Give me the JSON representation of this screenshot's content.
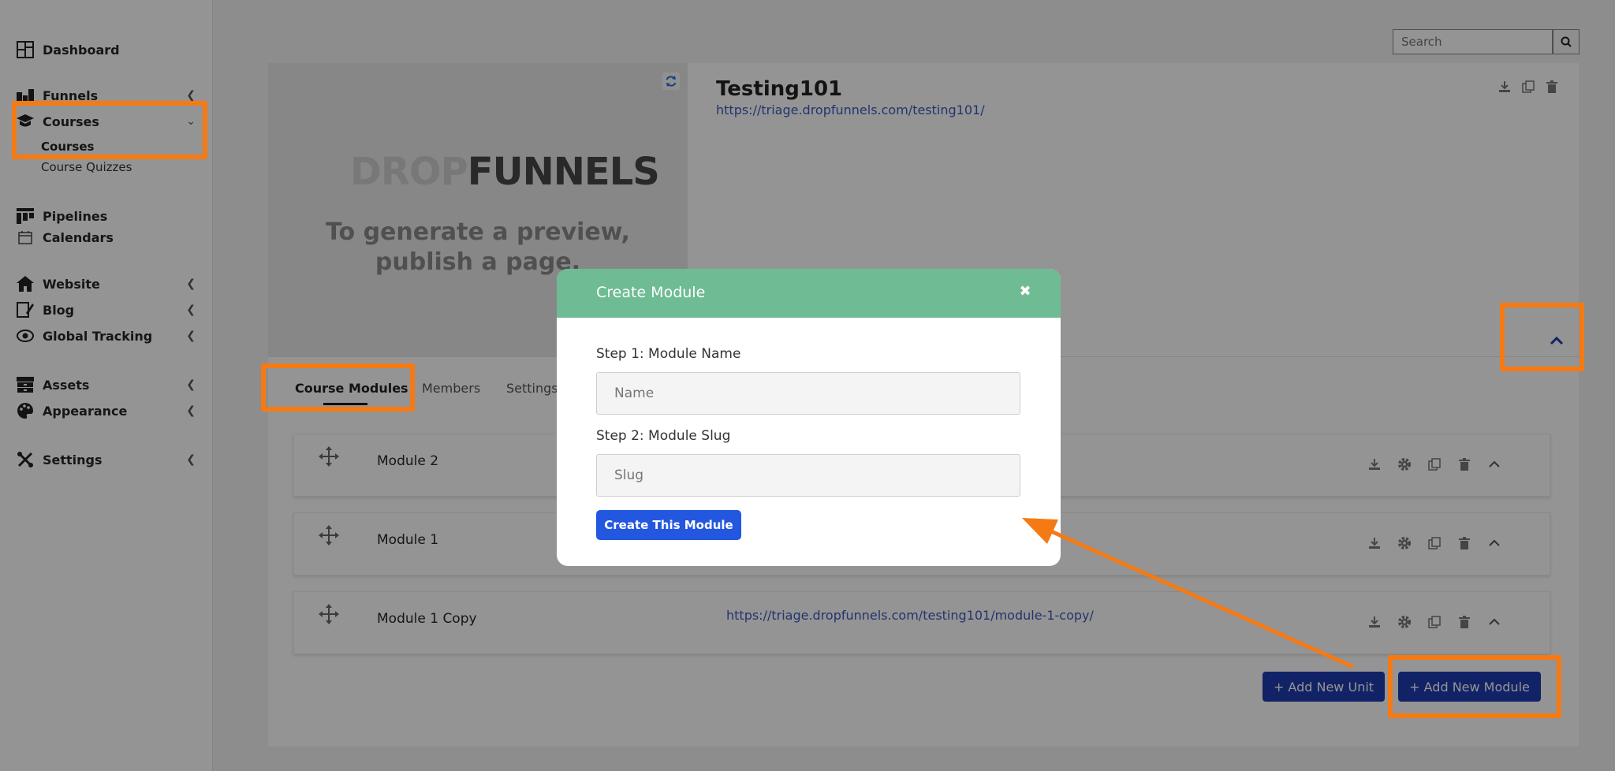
{
  "sidebar": {
    "dashboard": "Dashboard",
    "funnels": "Funnels",
    "courses": "Courses",
    "courses_sub": "Courses",
    "course_quizzes": "Course Quizzes",
    "pipelines": "Pipelines",
    "calendars": "Calendars",
    "website": "Website",
    "blog": "Blog",
    "global_tracking": "Global Tracking",
    "assets": "Assets",
    "appearance": "Appearance",
    "settings": "Settings"
  },
  "search": {
    "placeholder": "Search"
  },
  "course": {
    "title": "Testing101",
    "url": "https://triage.dropfunnels.com/testing101/",
    "preview_logo_drop": "DROP",
    "preview_logo_funnels": "FUNNELS",
    "preview_line1": "To generate a preview,",
    "preview_line2": "publish a page."
  },
  "tabs": [
    "Course Modules",
    "Members",
    "Settings"
  ],
  "modules": [
    {
      "name": "Module 2",
      "url": ""
    },
    {
      "name": "Module 1",
      "url": ""
    },
    {
      "name": "Module 1 Copy",
      "url": "https://triage.dropfunnels.com/testing101/module-1-copy/"
    }
  ],
  "buttons": {
    "add_unit": "+ Add New Unit",
    "add_module": "+ Add New Module"
  },
  "modal": {
    "title": "Create Module",
    "close_symbol": "✖",
    "step1_label": "Step 1: Module Name",
    "step1_placeholder": "Name",
    "step2_label": "Step 2: Module Slug",
    "step2_placeholder": "Slug",
    "submit": "Create This Module"
  },
  "colors": {
    "accent_green": "#6ebb94",
    "primary_blue": "#2357e0",
    "button_blue": "#1f3bb0",
    "highlight_orange": "#f57a14"
  }
}
